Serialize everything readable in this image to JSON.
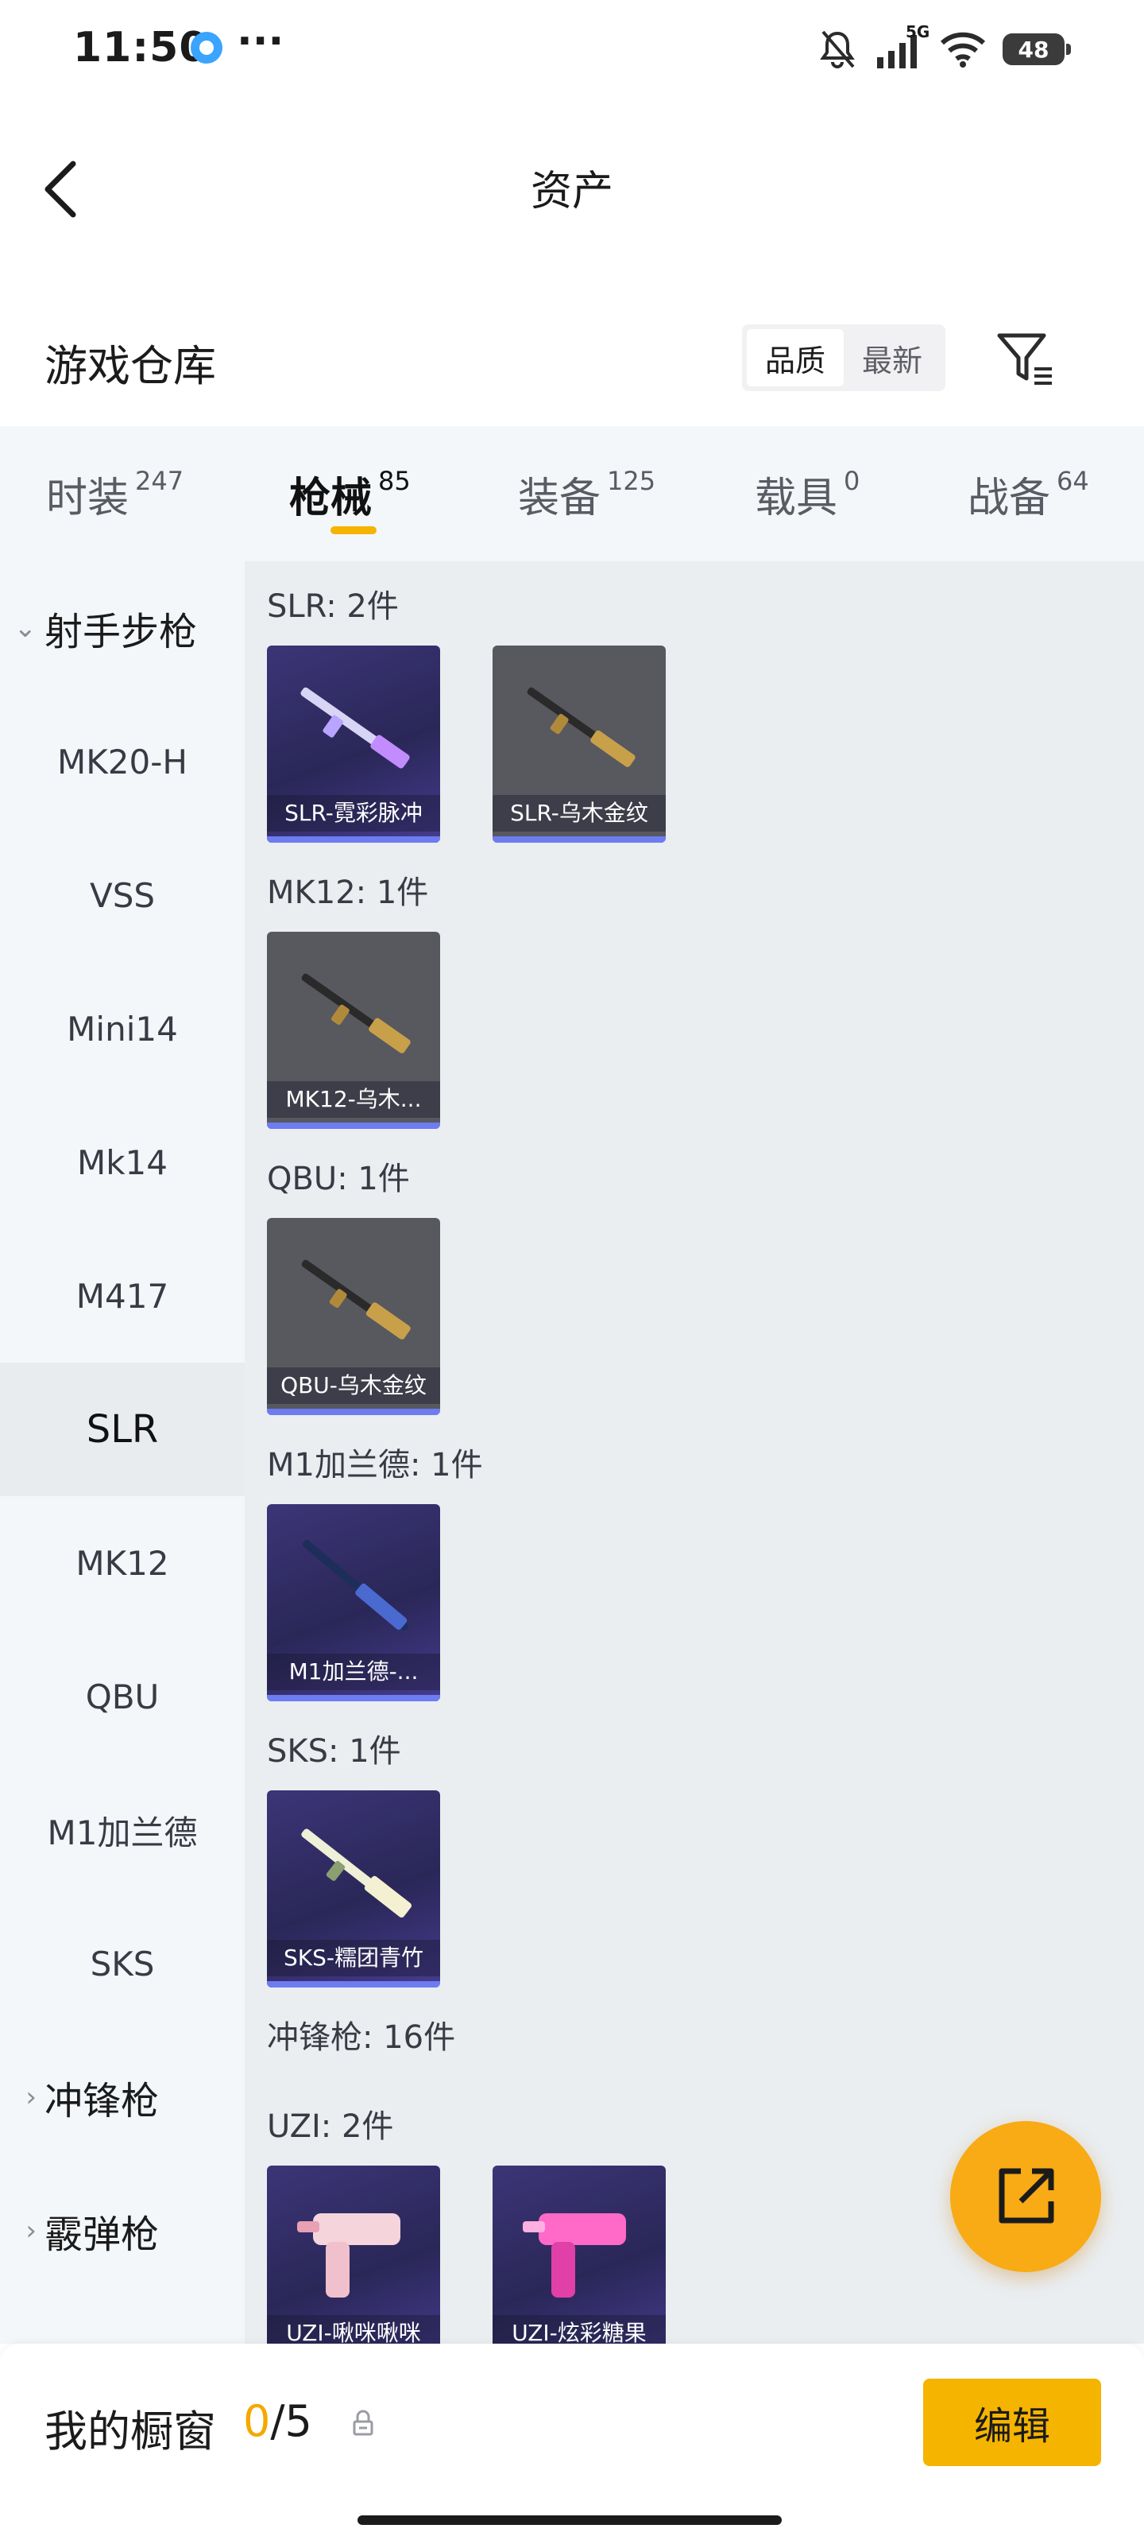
{
  "status": {
    "time": "11:50",
    "more": "···",
    "network": "5G",
    "battery": "48"
  },
  "header": {
    "title": "资产"
  },
  "warehouse": {
    "title": "游戏仓库",
    "sort_options": [
      "品质",
      "最新"
    ]
  },
  "tabs": [
    {
      "label": "时装",
      "count": "247"
    },
    {
      "label": "枪械",
      "count": "85"
    },
    {
      "label": "装备",
      "count": "125"
    },
    {
      "label": "载具",
      "count": "0"
    },
    {
      "label": "战备",
      "count": "64"
    }
  ],
  "sidebar": {
    "group_open": "射手步枪",
    "items": [
      "MK20-H",
      "VSS",
      "Mini14",
      "Mk14",
      "M417",
      "SLR",
      "MK12",
      "QBU",
      "M1加兰德",
      "SKS"
    ],
    "active_item": "SLR",
    "collapsed_groups": [
      "冲锋枪",
      "霰弹枪"
    ]
  },
  "content": {
    "groups": [
      {
        "title": "SLR: 2件",
        "cards": [
          "SLR-霓彩脉冲",
          "SLR-乌木金纹"
        ]
      },
      {
        "title": "MK12: 1件",
        "cards": [
          "MK12-乌木..."
        ]
      },
      {
        "title": "QBU: 1件",
        "cards": [
          "QBU-乌木金纹"
        ]
      },
      {
        "title": "M1加兰德: 1件",
        "cards": [
          "M1加兰德-..."
        ]
      },
      {
        "title": "SKS: 1件",
        "cards": [
          "SKS-糯团青竹"
        ]
      }
    ],
    "category_title": "冲锋枪: 16件",
    "uzi": {
      "title": "UZI: 2件",
      "cards": [
        "UZI-啾咪啾咪",
        "UZI-炫彩糖果"
      ]
    }
  },
  "bottom": {
    "showcase_label": "我的橱窗",
    "showcase_current": "0",
    "showcase_total": "/5",
    "edit_label": "编辑"
  },
  "colors": {
    "accent": "#f5b400",
    "card_purple": "#2a2758",
    "card_gray": "#58585f",
    "card_stripe": "#6d7cf0"
  }
}
